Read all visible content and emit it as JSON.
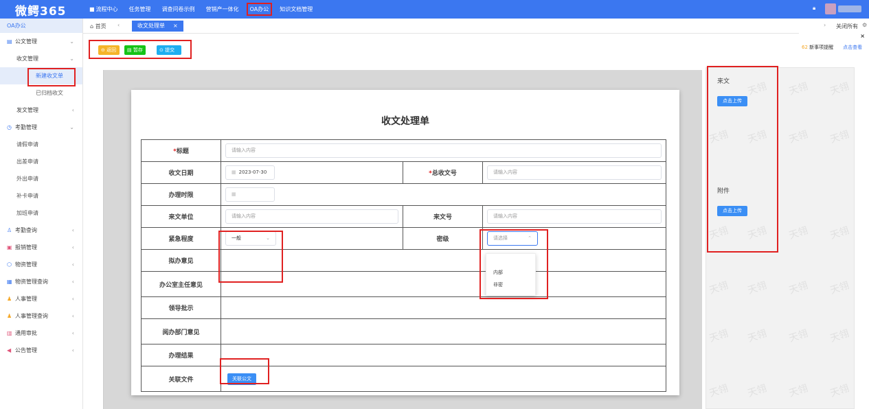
{
  "app": {
    "logo": "微鳄365"
  },
  "topnav": [
    {
      "label": "流程中心",
      "icon": "grid-icon"
    },
    {
      "label": "任务管理"
    },
    {
      "label": "调查问卷示例"
    },
    {
      "label": "营销产一体化"
    },
    {
      "label": "OA办公"
    },
    {
      "label": "知识文档管理"
    }
  ],
  "sidebar": {
    "title": "OA办公",
    "items": [
      {
        "label": "公文管理",
        "arrow": "⌄"
      },
      {
        "label": "收文管理",
        "arrow": "⌄"
      },
      {
        "label": "新建收文单"
      },
      {
        "label": "已归档收文"
      },
      {
        "label": "发文管理",
        "arrow": "‹"
      },
      {
        "label": "考勤管理",
        "arrow": "⌄"
      },
      {
        "label": "请假申请"
      },
      {
        "label": "出差申请"
      },
      {
        "label": "外出申请"
      },
      {
        "label": "补卡申请"
      },
      {
        "label": "加班申请"
      },
      {
        "label": "考勤查询",
        "arrow": "‹"
      },
      {
        "label": "报销管理",
        "arrow": "‹"
      },
      {
        "label": "物资管理",
        "arrow": "‹"
      },
      {
        "label": "物资管理查询",
        "arrow": "‹"
      },
      {
        "label": "人事管理",
        "arrow": "‹"
      },
      {
        "label": "人事管理查询",
        "arrow": "‹"
      },
      {
        "label": "通用审批",
        "arrow": "‹"
      },
      {
        "label": "公告管理",
        "arrow": "‹"
      }
    ]
  },
  "tabs": {
    "home": "首页",
    "active": "收文处理单",
    "close_all": "关闭所有"
  },
  "toolbar": {
    "back": "返回",
    "save": "暂存",
    "submit": "提交"
  },
  "notice": {
    "count": "62",
    "text": "新事项提醒",
    "link": "点击查看"
  },
  "form": {
    "title": "收文处理单",
    "labels": {
      "subject": "标题",
      "date": "收文日期",
      "total_no": "总收文号",
      "deadline": "办理时限",
      "sender": "来文单位",
      "doc_no": "来文号",
      "urgency": "紧急程度",
      "secrecy": "密级",
      "draft_opinion": "拟办意见",
      "office_director_opinion": "办公室主任意见",
      "leader_instruction": "领导批示",
      "reader_dept_opinion": "阅办部门意见",
      "result": "办理结果",
      "related_files": "关联文件"
    },
    "placeholder": "请输入内容",
    "date_value": "2023-07-30",
    "urgency_value": "一般",
    "secrecy_placeholder": "请选择",
    "secrecy_options": [
      "",
      "内部",
      "非密"
    ],
    "related_button": "关联公文"
  },
  "right_panel": {
    "incoming_title": "来文",
    "attachment_title": "附件",
    "upload_label": "点击上传",
    "watermark": "天翎"
  }
}
